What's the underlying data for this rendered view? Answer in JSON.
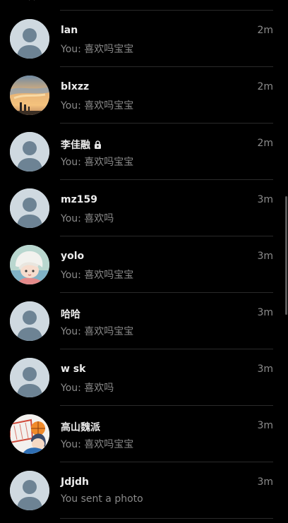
{
  "conversations": [
    {
      "name": "lan",
      "time": "2m",
      "preview": "You: 喜欢吗宝宝",
      "avatar": "default-avatar-icon",
      "locked": false
    },
    {
      "name": "blxzz",
      "time": "2m",
      "preview": "You: 喜欢吗宝宝",
      "avatar": "sunset-photo-avatar",
      "locked": false
    },
    {
      "name": "李佳融",
      "time": "2m",
      "preview": "You: 喜欢吗宝宝",
      "avatar": "default-avatar-icon",
      "locked": true
    },
    {
      "name": "mz159",
      "time": "3m",
      "preview": "You: 喜欢吗",
      "avatar": "default-avatar-icon",
      "locked": false
    },
    {
      "name": "yolo",
      "time": "3m",
      "preview": "You: 喜欢吗宝宝",
      "avatar": "anime-character-avatar",
      "locked": false
    },
    {
      "name": "哈哈",
      "time": "3m",
      "preview": "You: 喜欢吗宝宝",
      "avatar": "default-avatar-icon",
      "locked": false
    },
    {
      "name": "w sk",
      "time": "3m",
      "preview": "You: 喜欢吗",
      "avatar": "default-avatar-icon",
      "locked": false
    },
    {
      "name": "高山魏派",
      "time": "3m",
      "preview": "You: 喜欢吗宝宝",
      "avatar": "basketball-anime-avatar",
      "locked": false
    },
    {
      "name": "Jdjdh",
      "time": "3m",
      "preview": "You sent a photo",
      "avatar": "default-avatar-icon",
      "locked": false
    }
  ],
  "icons": {
    "lock": "lock-icon",
    "top": "chevron-up-icon"
  },
  "colors": {
    "background": "#000000",
    "name": "#ececec",
    "muted": "#8a8a8a",
    "divider": "#2a2a2a",
    "default_avatar_bg": "#cfd9e0",
    "default_avatar_fg": "#6d8394"
  }
}
